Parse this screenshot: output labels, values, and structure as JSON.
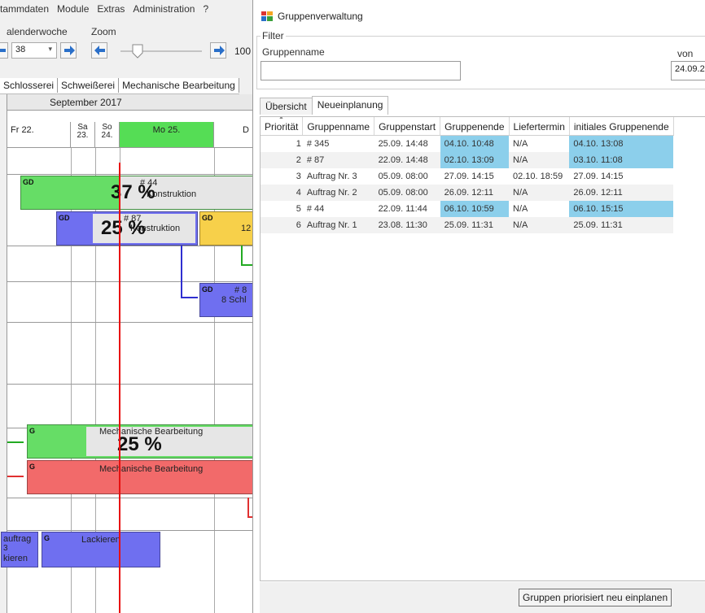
{
  "left_app": {
    "menu": [
      "tammdaten",
      "Module",
      "Extras",
      "Administration",
      "?"
    ],
    "week_label": "alenderwoche",
    "zoom_label": "Zoom",
    "week_value": "38",
    "zoom_value": "100",
    "tabs": [
      "Schlosserei",
      "Schweißerei",
      "Mechanische Bearbeitung"
    ],
    "month": "September 2017",
    "days": {
      "fr": "Fr 22.",
      "sa_top": "Sa",
      "sa_bot": "23.",
      "so_top": "So",
      "so_bot": "24.",
      "mo": "Mo 25.",
      "next": "D"
    },
    "bars": {
      "b1_icons": "GD",
      "b1_id": "# 44",
      "b1_text": "Konstruktion",
      "b1_pct": "37 %",
      "b2_icons": "GD",
      "b2_id": "# 87",
      "b2_text": "Konstruktion",
      "b2_pct": "25 %",
      "b3_icons": "GD",
      "b3_text": "12",
      "b4_icons": "GD",
      "b4_id": "# 8",
      "b4_text": "8 Schl",
      "b5_icon": "G",
      "b5_text": "Mechanische Bearbeitung",
      "b5_pct": "25 %",
      "b6_icon": "G",
      "b6_text": "Mechanische Bearbeitung",
      "b7_left": "auftrag",
      "b7_icon": "G",
      "b7_text": "Lackieren",
      "b7_sub1": "3",
      "b7_sub2": "kieren"
    }
  },
  "dialog": {
    "title": "Gruppenverwaltung",
    "filter_legend": "Filter",
    "name_label": "Gruppenname",
    "name_value": "",
    "from_label": "von",
    "from_value": "24.09.2",
    "tabs": [
      "Übersicht",
      "Neueinplanung"
    ],
    "active_tab": "Neueinplanung",
    "columns": [
      "Priorität",
      "Gruppenname",
      "Gruppenstart",
      "Gruppenende",
      "Liefertermin",
      "initiales Gruppenende"
    ],
    "rows": [
      {
        "prio": "1",
        "name": "# 345",
        "start": "25.09. 14:48",
        "end": "04.10. 10:48",
        "delivery": "N/A",
        "initial": "04.10. 13:08"
      },
      {
        "prio": "2",
        "name": "# 87",
        "start": "22.09. 14:48",
        "end": "02.10. 13:09",
        "delivery": "N/A",
        "initial": "03.10. 11:08"
      },
      {
        "prio": "3",
        "name": "Auftrag Nr. 3",
        "start": "05.09. 08:00",
        "end": "27.09. 14:15",
        "delivery": "02.10. 18:59",
        "initial": "27.09. 14:15"
      },
      {
        "prio": "4",
        "name": "Auftrag Nr. 2",
        "start": "05.09. 08:00",
        "end": "26.09. 12:11",
        "delivery": "N/A",
        "initial": "26.09. 12:11"
      },
      {
        "prio": "5",
        "name": "# 44",
        "start": "22.09. 11:44",
        "end": "06.10. 10:59",
        "delivery": "N/A",
        "initial": "06.10. 15:15"
      },
      {
        "prio": "6",
        "name": "Auftrag Nr. 1",
        "start": "23.08. 11:30",
        "end": "25.09. 11:31",
        "delivery": "N/A",
        "initial": "25.09. 11:31"
      }
    ],
    "button_label": "Gruppen priorisiert neu einplanen"
  },
  "colors": {
    "highlight": "#8ccfeb",
    "green_bar": "#66dd66",
    "blue_bar": "#6f6ff0",
    "yellow_bar": "#f7d04a",
    "red_bar": "#f26a6a",
    "current_time_line": "#e81010"
  }
}
